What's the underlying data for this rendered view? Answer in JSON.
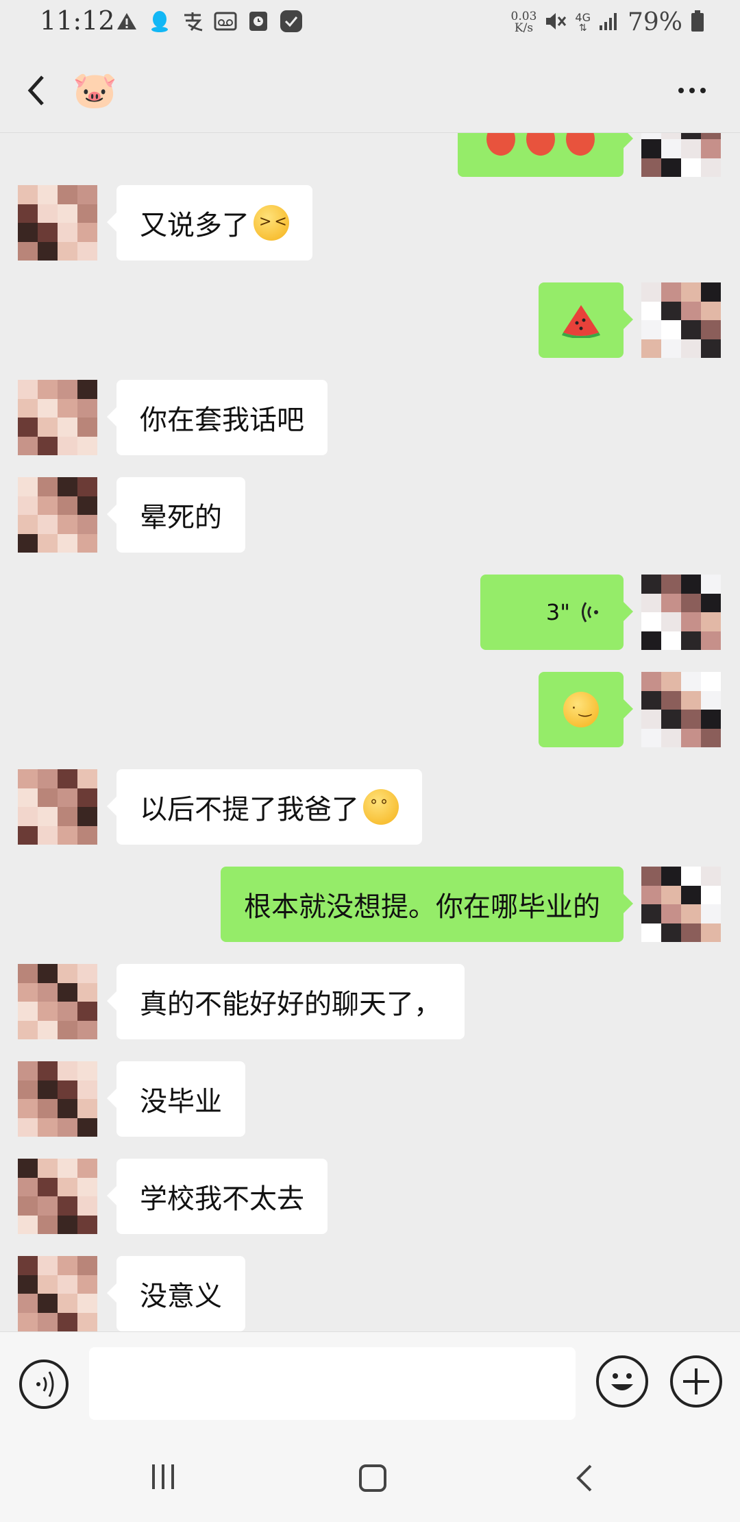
{
  "status_bar": {
    "time": "11:12",
    "net_speed_value": "0.03",
    "net_speed_unit": "K/s",
    "network": "4G",
    "battery": "79%"
  },
  "header": {
    "contact_name_emoji": "🐷"
  },
  "messages": [
    {
      "side": "out",
      "text": "",
      "note": "partial emoji row (cropped)"
    },
    {
      "side": "in",
      "text": "又说多了"
    },
    {
      "side": "out",
      "text": ""
    },
    {
      "side": "in",
      "text": "你在套我话吧"
    },
    {
      "side": "in",
      "text": "晕死的"
    },
    {
      "side": "out",
      "text": "3\""
    },
    {
      "side": "out",
      "text": ""
    },
    {
      "side": "in",
      "text": "以后不提了我爸了"
    },
    {
      "side": "out",
      "text": "根本就没想提。你在哪毕业的"
    },
    {
      "side": "in",
      "text": "真的不能好好的聊天了，"
    },
    {
      "side": "in",
      "text": "没毕业"
    },
    {
      "side": "in",
      "text": "学校我不太去"
    },
    {
      "side": "in",
      "text": "没意义"
    }
  ],
  "colors": {
    "background": "#ededed",
    "bubble_out": "#95ec69",
    "bubble_in": "#ffffff"
  },
  "icons": {
    "voice": "voice-input-icon",
    "emoji": "emoji-icon",
    "plus": "plus-icon"
  }
}
